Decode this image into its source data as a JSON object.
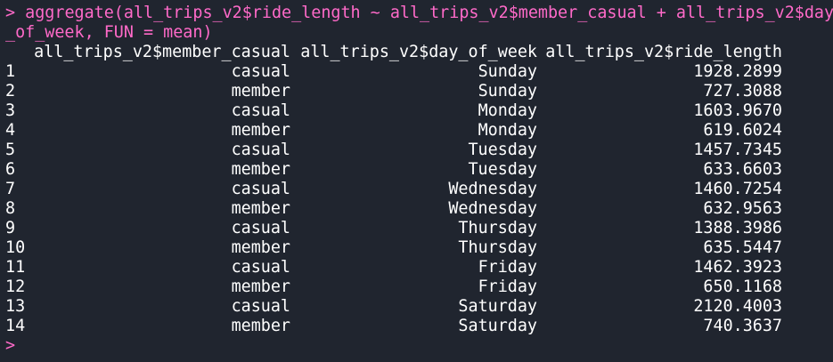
{
  "console": {
    "prompt_symbol": ">",
    "command_line_1": "aggregate(all_trips_v2$ride_length ~ all_trips_v2$member_casual + all_trips_v2$day",
    "command_line_2": "_of_week, FUN = mean)",
    "empty_prompt": ">"
  },
  "table": {
    "headers": [
      "all_trips_v2$member_casual",
      "all_trips_v2$day_of_week",
      "all_trips_v2$ride_length"
    ],
    "rows": [
      {
        "idx": "1",
        "member_casual": "casual",
        "day_of_week": "Sunday",
        "ride_length": "1928.2899"
      },
      {
        "idx": "2",
        "member_casual": "member",
        "day_of_week": "Sunday",
        "ride_length": "727.3088"
      },
      {
        "idx": "3",
        "member_casual": "casual",
        "day_of_week": "Monday",
        "ride_length": "1603.9670"
      },
      {
        "idx": "4",
        "member_casual": "member",
        "day_of_week": "Monday",
        "ride_length": "619.6024"
      },
      {
        "idx": "5",
        "member_casual": "casual",
        "day_of_week": "Tuesday",
        "ride_length": "1457.7345"
      },
      {
        "idx": "6",
        "member_casual": "member",
        "day_of_week": "Tuesday",
        "ride_length": "633.6603"
      },
      {
        "idx": "7",
        "member_casual": "casual",
        "day_of_week": "Wednesday",
        "ride_length": "1460.7254"
      },
      {
        "idx": "8",
        "member_casual": "member",
        "day_of_week": "Wednesday",
        "ride_length": "632.9563"
      },
      {
        "idx": "9",
        "member_casual": "casual",
        "day_of_week": "Thursday",
        "ride_length": "1388.3986"
      },
      {
        "idx": "10",
        "member_casual": "member",
        "day_of_week": "Thursday",
        "ride_length": "635.5447"
      },
      {
        "idx": "11",
        "member_casual": "casual",
        "day_of_week": "Friday",
        "ride_length": "1462.3923"
      },
      {
        "idx": "12",
        "member_casual": "member",
        "day_of_week": "Friday",
        "ride_length": "650.1168"
      },
      {
        "idx": "13",
        "member_casual": "casual",
        "day_of_week": "Saturday",
        "ride_length": "2120.4003"
      },
      {
        "idx": "14",
        "member_casual": "member",
        "day_of_week": "Saturday",
        "ride_length": "740.3637"
      }
    ]
  },
  "colors": {
    "background": "#20252f",
    "prompt_and_command": "#ff6ac9",
    "output_text": "#ffffff"
  }
}
